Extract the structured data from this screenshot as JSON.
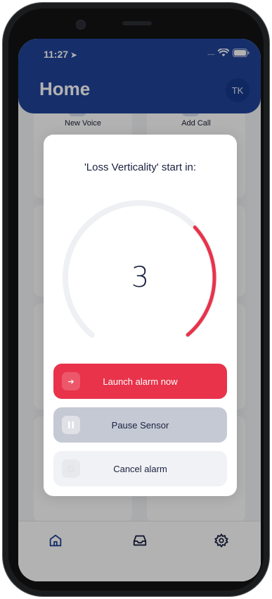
{
  "status_bar": {
    "time": "11:27",
    "signal": "....."
  },
  "header": {
    "title": "Home",
    "avatar_initials": "TK"
  },
  "tiles": [
    {
      "label": "New Voice"
    },
    {
      "label": "Add Call"
    }
  ],
  "modal": {
    "title": "'Loss Verticality'  start in:",
    "countdown": "3",
    "countdown_progress": 0.33,
    "buttons": {
      "launch": "Launch alarm now",
      "pause": "Pause Sensor",
      "cancel": "Cancel alarm"
    }
  },
  "bottom_nav": {
    "icons": [
      "home-icon",
      "inbox-icon",
      "settings-icon"
    ]
  },
  "colors": {
    "header": "#20449a",
    "accent_red": "#e8334a",
    "pause_gray": "#c5c9d4",
    "cancel_gray": "#f1f2f5"
  }
}
